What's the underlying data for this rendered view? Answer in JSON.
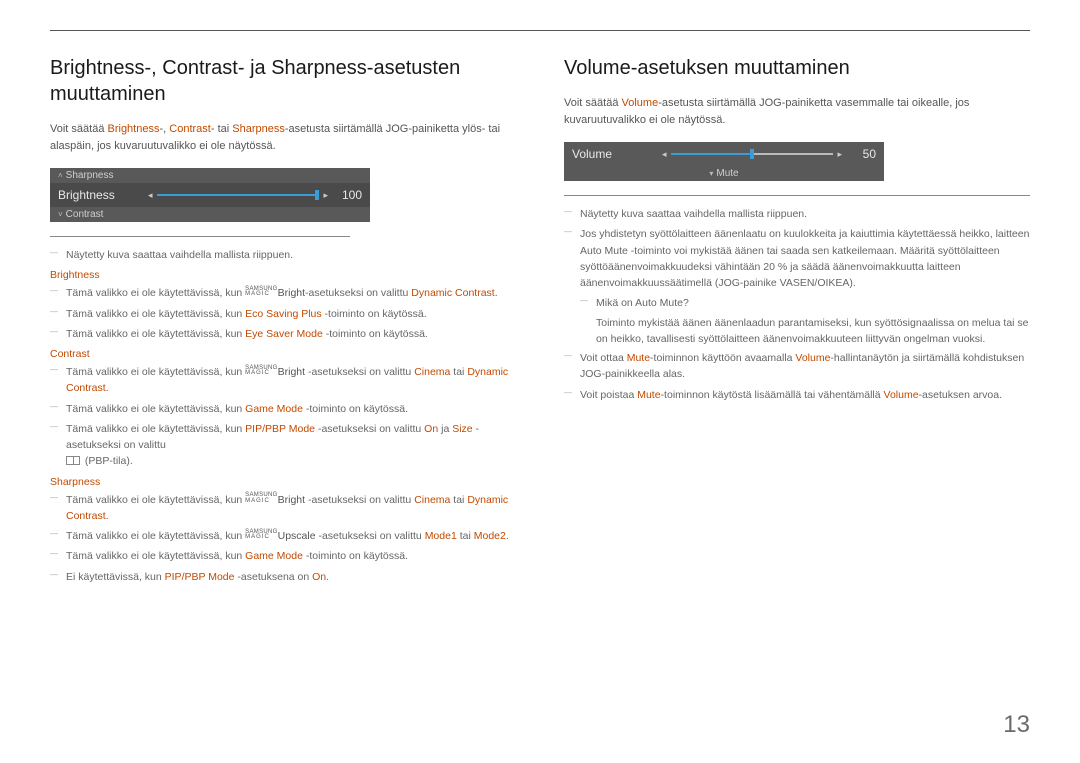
{
  "page_number": "13",
  "left": {
    "title": "Brightness-, Contrast- ja Sharpness-asetusten muuttaminen",
    "intro_pre": "Voit säätää ",
    "intro_b": "Brightness",
    "intro_sep1": "-, ",
    "intro_c": "Contrast",
    "intro_sep2": "- tai ",
    "intro_s": "Sharpness",
    "intro_post": "-asetusta siirtämällä JOG-painiketta ylös- tai alaspäin, jos kuvaruutuvalikko ei ole näytössä.",
    "osd": {
      "top": "Sharpness",
      "main": "Brightness",
      "value": "100",
      "bottom": "Contrast"
    },
    "note1": "Näytetty kuva saattaa vaihdella mallista riippuen.",
    "sub_brightness": "Brightness",
    "b_menu_prefix": "Tämä valikko ei ole käytettävissä, kun ",
    "b_bright": "Bright",
    "b_bright_mid": "-asetukseksi on valittu ",
    "b_dyn": "Dynamic Contrast",
    "b_eco": "Eco Saving Plus",
    "b_eco_suffix": " -toiminto on käytössä.",
    "b_eye": "Eye Saver Mode",
    "b_eye_suffix": " -toiminto on käytössä.",
    "sub_contrast": "Contrast",
    "c_cinema": "Cinema",
    "c_tai": " tai ",
    "c_dyn": "Dynamic Contrast",
    "c_game": "Game Mode",
    "c_game_suffix": " -toiminto on käytössä.",
    "c_pip": "PIP/PBP Mode",
    "c_pip_mid": " -asetukseksi on valittu ",
    "c_on": "On",
    "c_ja": " ja ",
    "c_size": "Size",
    "c_size_mid": " -asetukseksi on valittu",
    "c_pbp": " (PBP-tila).",
    "sub_sharpness": "Sharpness",
    "s_upscale": "Upscale",
    "s_up_mid": "  -asetukseksi on valittu ",
    "s_mode1": "Mode1",
    "s_mode2": "Mode2",
    "s_last_pre": "Ei käytettävissä, kun ",
    "s_last_pip": "PIP/PBP Mode",
    "s_last_mid": " -asetuksena on ",
    "s_last_on": "On"
  },
  "right": {
    "title": "Volume-asetuksen muuttaminen",
    "intro_pre": "Voit säätää ",
    "intro_v": "Volume",
    "intro_post": "-asetusta siirtämällä JOG-painiketta vasemmalle tai oikealle, jos kuvaruutuvalikko ei ole näytössä.",
    "osd": {
      "main": "Volume",
      "value": "50",
      "bottom": "Mute"
    },
    "note1": "Näytetty kuva saattaa vaihdella mallista riippuen.",
    "note2": "Jos yhdistetyn syöttölaitteen äänenlaatu on kuulokkeita ja kaiuttimia käytettäessä heikko, laitteen Auto Mute -toiminto voi mykistää äänen tai saada sen katkeilemaan. Määritä syöttölaitteen syöttöäänenvoimakkuudeksi vähintään 20 % ja säädä äänenvoimakkuutta laitteen äänenvoimakkuussäätimellä (JOG-painike VASEN/OIKEA).",
    "note2a": "Mikä on Auto Mute?",
    "note2b": "Toiminto mykistää äänen äänenlaadun parantamiseksi, kun syöttösignaalissa on melua tai se on heikko, tavallisesti syöttölaitteen äänenvoimakkuuteen liittyvän ongelman vuoksi.",
    "note3_pre": "Voit ottaa ",
    "note3_mute": "Mute",
    "note3_mid": "-toiminnon käyttöön avaamalla ",
    "note3_vol": "Volume",
    "note3_post": "-hallintanäytön ja siirtämällä kohdistuksen JOG-painikkeella alas.",
    "note4_pre": "Voit poistaa ",
    "note4_mid": "-toiminnon käytöstä lisäämällä tai vähentämällä ",
    "note4_post": "-asetuksen arvoa."
  },
  "magic": {
    "top": "SAMSUNG",
    "bot": "MAGIC"
  }
}
